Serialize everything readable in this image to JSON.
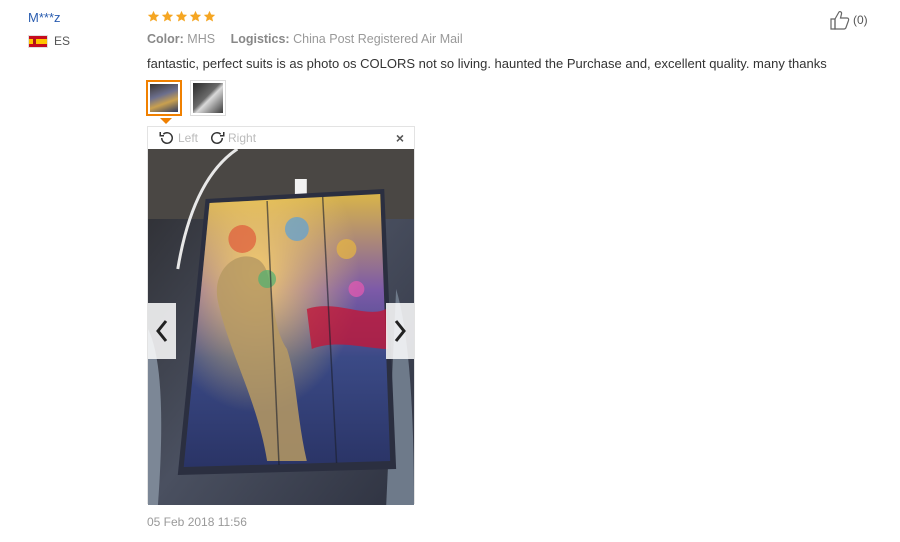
{
  "reviewer": {
    "name": "M***z",
    "country": "ES"
  },
  "rating": {
    "stars": 5
  },
  "meta": {
    "color_label": "Color:",
    "color_value": "MHS",
    "logistics_label": "Logistics:",
    "logistics_value": "China Post Registered Air Mail"
  },
  "review_text": "fantastic, perfect suits is as photo os COLORS not so living. haunted the Purchase and, excellent quality. many thanks",
  "viewer": {
    "rotate_left": "Left",
    "rotate_right": "Right",
    "close": "×"
  },
  "date": "05 Feb 2018 11:56",
  "helpful": {
    "count": "(0)"
  },
  "colors": {
    "accent": "#f08000",
    "star": "#f5a623",
    "link": "#2a5db0"
  }
}
